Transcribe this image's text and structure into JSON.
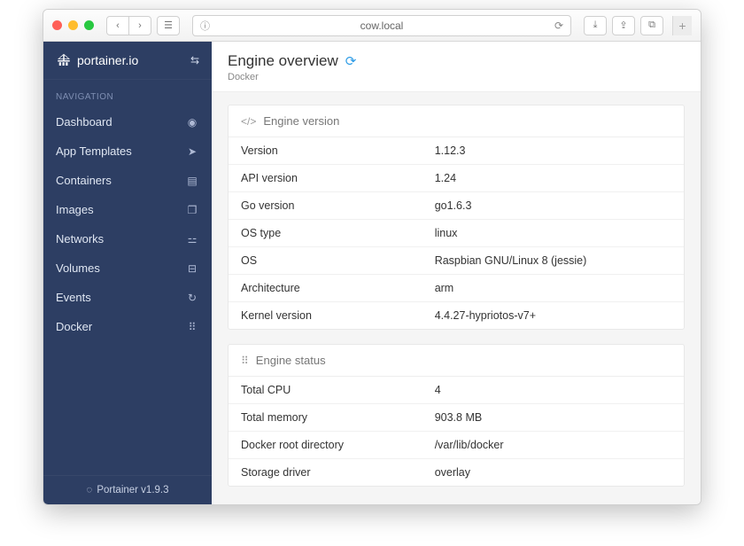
{
  "browser": {
    "url": "cow.local"
  },
  "brand": {
    "name": "portainer.io"
  },
  "nav": {
    "title": "NAVIGATION",
    "items": [
      {
        "label": "Dashboard",
        "icon": "dashboard-icon",
        "glyph": "◉"
      },
      {
        "label": "App Templates",
        "icon": "rocket-icon",
        "glyph": "➤"
      },
      {
        "label": "Containers",
        "icon": "list-icon",
        "glyph": "▤"
      },
      {
        "label": "Images",
        "icon": "clone-icon",
        "glyph": "❐"
      },
      {
        "label": "Networks",
        "icon": "sitemap-icon",
        "glyph": "⚍"
      },
      {
        "label": "Volumes",
        "icon": "hdd-icon",
        "glyph": "⊟"
      },
      {
        "label": "Events",
        "icon": "history-icon",
        "glyph": "↻"
      },
      {
        "label": "Docker",
        "icon": "th-icon",
        "glyph": "⠿"
      }
    ]
  },
  "footer": {
    "text": "Portainer v1.9.3"
  },
  "page": {
    "title": "Engine overview",
    "breadcrumb": "Docker"
  },
  "panels": {
    "engine_version": {
      "title": "Engine version",
      "rows": [
        {
          "k": "Version",
          "v": "1.12.3"
        },
        {
          "k": "API version",
          "v": "1.24"
        },
        {
          "k": "Go version",
          "v": "go1.6.3"
        },
        {
          "k": "OS type",
          "v": "linux"
        },
        {
          "k": "OS",
          "v": "Raspbian GNU/Linux 8 (jessie)"
        },
        {
          "k": "Architecture",
          "v": "arm"
        },
        {
          "k": "Kernel version",
          "v": "4.4.27-hypriotos-v7+"
        }
      ]
    },
    "engine_status": {
      "title": "Engine status",
      "rows": [
        {
          "k": "Total CPU",
          "v": "4"
        },
        {
          "k": "Total memory",
          "v": "903.8 MB"
        },
        {
          "k": "Docker root directory",
          "v": "/var/lib/docker"
        },
        {
          "k": "Storage driver",
          "v": "overlay"
        }
      ]
    }
  }
}
